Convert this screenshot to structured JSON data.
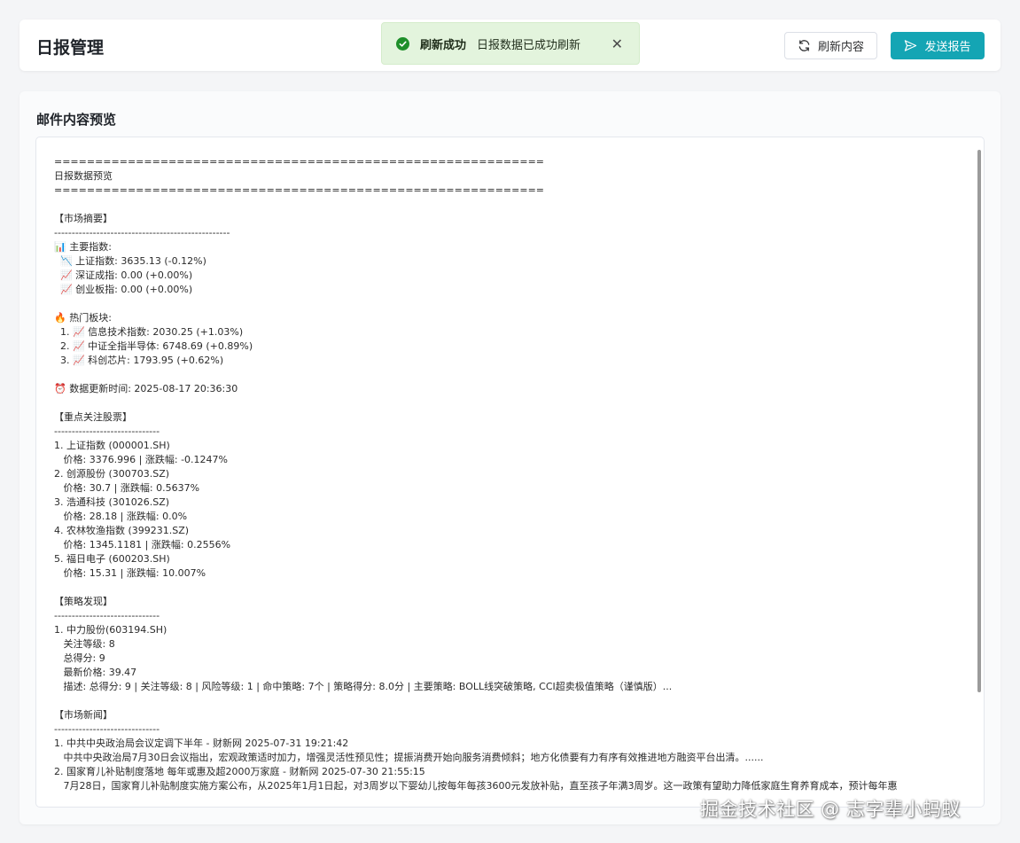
{
  "header": {
    "title": "日报管理",
    "refresh_label": "刷新内容",
    "send_label": "发送报告"
  },
  "toast": {
    "title": "刷新成功",
    "message": "日报数据已成功刷新",
    "close_symbol": "✕"
  },
  "preview": {
    "section_title": "邮件内容预览",
    "lines": [
      "============================================================",
      "日报数据预览",
      "============================================================",
      "",
      "【市场摘要】",
      "--------------------------------------------------",
      "📊 主要指数:",
      "  📉 上证指数: 3635.13 (-0.12%)",
      "  📈 深证成指: 0.00 (+0.00%)",
      "  📈 创业板指: 0.00 (+0.00%)",
      "",
      "🔥 热门板块:",
      "  1. 📈 信息技术指数: 2030.25 (+1.03%)",
      "  2. 📈 中证全指半导体: 6748.69 (+0.89%)",
      "  3. 📈 科创芯片: 1793.95 (+0.62%)",
      "",
      "⏰ 数据更新时间: 2025-08-17 20:36:30",
      "",
      "【重点关注股票】",
      "------------------------------",
      "1. 上证指数 (000001.SH)",
      "   价格: 3376.996 | 涨跌幅: -0.1247%",
      "2. 创源股份 (300703.SZ)",
      "   价格: 30.7 | 涨跌幅: 0.5637%",
      "3. 浩通科技 (301026.SZ)",
      "   价格: 28.18 | 涨跌幅: 0.0%",
      "4. 农林牧渔指数 (399231.SZ)",
      "   价格: 1345.1181 | 涨跌幅: 0.2556%",
      "5. 福日电子 (600203.SH)",
      "   价格: 15.31 | 涨跌幅: 10.007%",
      "",
      "【策略发现】",
      "------------------------------",
      "1. 中力股份(603194.SH)",
      "   关注等级: 8",
      "   总得分: 9",
      "   最新价格: 39.47",
      "   描述: 总得分: 9 | 关注等级: 8 | 风险等级: 1 | 命中策略: 7个 | 策略得分: 8.0分 | 主要策略: BOLL线突破策略, CCI超卖极值策略（谨慎版）...",
      "",
      "【市场新闻】",
      "------------------------------",
      "1. 中共中央政治局会议定调下半年 - 财新网 2025-07-31 19:21:42",
      "   中共中央政治局7月30日会议指出，宏观政策适时加力，增强灵活性预见性；提振消费开始向服务消费倾斜；地方化债要有力有序有效推进地方融资平台出清。......",
      "2. 国家育儿补贴制度落地 每年或惠及超2000万家庭 - 财新网 2025-07-30 21:55:15",
      "   7月28日，国家育儿补贴制度实施方案公布，从2025年1月1日起，对3周岁以下婴幼儿按每年每孩3600元发放补贴，直至孩子年满3周岁。这一政策有望助力降低家庭生育养育成本，预计每年惠"
    ]
  },
  "watermark": "掘金技术社区 @ 志字辈小蚂蚁"
}
